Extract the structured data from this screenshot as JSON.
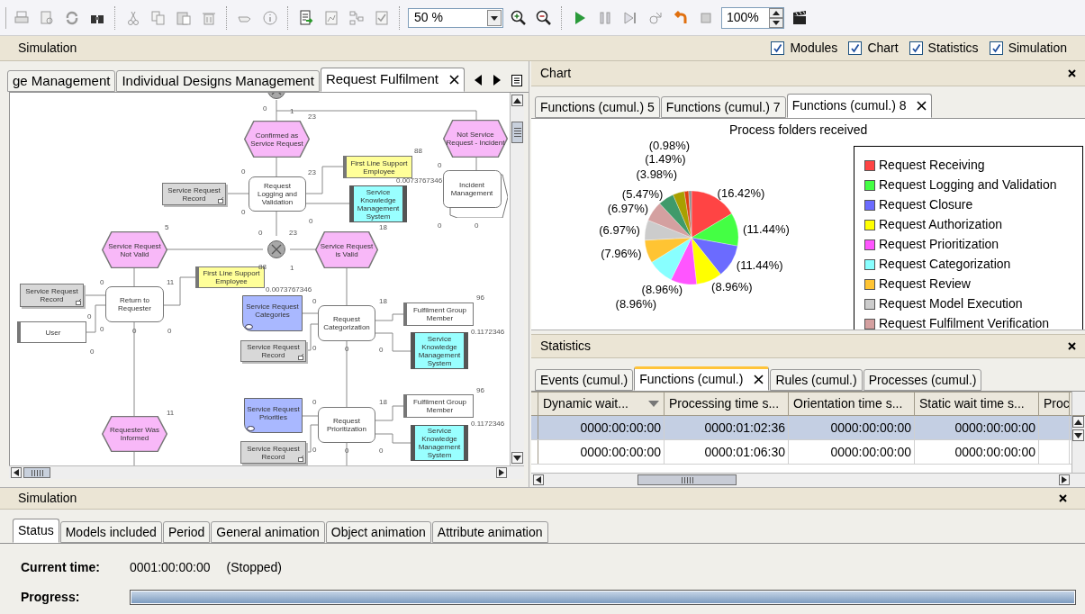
{
  "toolbar": {
    "zoom": "50 %",
    "speed": "100%"
  },
  "simulation_bar": {
    "title": "Simulation",
    "panels": [
      {
        "label": "Modules",
        "checked": true
      },
      {
        "label": "Chart",
        "checked": true
      },
      {
        "label": "Statistics",
        "checked": true
      },
      {
        "label": "Simulation",
        "checked": true
      }
    ]
  },
  "model_tabs": [
    {
      "label": "ge Management",
      "selected": false
    },
    {
      "label": "Individual Designs Management",
      "selected": false
    },
    {
      "label": "Request Fulfilment",
      "selected": true
    }
  ],
  "diagram": {
    "nodes": [
      {
        "kind": "event",
        "label": "Confirmed as Service Request"
      },
      {
        "kind": "event",
        "label": "Not Service Request - Incident"
      },
      {
        "kind": "xor"
      },
      {
        "kind": "function",
        "label": "Request Logging and Validation"
      },
      {
        "kind": "organisation",
        "label": "First Line Support Employee"
      },
      {
        "kind": "information",
        "label": "Service Request Record"
      },
      {
        "kind": "application",
        "label": "Service Knowledge Management System"
      },
      {
        "kind": "process_interface",
        "label": "Incident Management"
      },
      {
        "kind": "xor"
      },
      {
        "kind": "event",
        "label": "Service Request Not Valid"
      },
      {
        "kind": "event",
        "label": "Service Request is Valid"
      },
      {
        "kind": "organisation",
        "label": "First Line Support Employee"
      },
      {
        "kind": "information",
        "label": "Service Request Record"
      },
      {
        "kind": "function",
        "label": "Return to Requester"
      },
      {
        "kind": "position",
        "label": "User"
      },
      {
        "kind": "document",
        "label": "Service Request Categories"
      },
      {
        "kind": "function",
        "label": "Request Categorization"
      },
      {
        "kind": "position",
        "label": "Fulfilment Group Member"
      },
      {
        "kind": "information",
        "label": "Service Request Record"
      },
      {
        "kind": "application",
        "label": "Service Knowledge Management System"
      },
      {
        "kind": "event",
        "label": "Requester Was Informed"
      },
      {
        "kind": "document",
        "label": "Service Request Priorities"
      },
      {
        "kind": "function",
        "label": "Request Prioritization"
      },
      {
        "kind": "position",
        "label": "Fulfilment Group Member"
      },
      {
        "kind": "information",
        "label": "Service Request Record"
      },
      {
        "kind": "application",
        "label": "Service Knowledge Management System"
      }
    ],
    "labels": [
      "0",
      "1",
      "23",
      "88",
      "0",
      "23",
      "0",
      "0.0073767346",
      "0",
      "0",
      "18",
      "0",
      "0",
      "5",
      "0",
      "23",
      "88",
      "1",
      "0",
      "11",
      "0",
      "0",
      "0",
      "0",
      "0",
      "0.0073767346",
      "0",
      "18",
      "96",
      "0.1172346",
      "0",
      "0",
      "0",
      "11",
      "0",
      "18",
      "96",
      "0.1172346",
      "0",
      "0",
      "0"
    ]
  },
  "chart": {
    "title": "Chart",
    "tabs": [
      {
        "label": "Functions (cumul.) 5",
        "selected": false
      },
      {
        "label": "Functions (cumul.) 7",
        "selected": false
      },
      {
        "label": "Functions (cumul.) 8",
        "selected": true
      }
    ],
    "chart_data": {
      "type": "pie",
      "title": "Process folders received",
      "values": [
        16.42,
        11.44,
        11.44,
        8.96,
        8.96,
        8.96,
        7.96,
        6.97,
        6.97,
        5.47,
        3.98,
        1.49,
        0.98
      ],
      "value_labels": [
        "(16.42%)",
        "(11.44%)",
        "(11.44%)",
        "(8.96%)",
        "(8.96%)",
        "(8.96%)",
        "(7.96%)",
        "(6.97%)",
        "(6.97%)",
        "(5.47%)",
        "(3.98%)",
        "(1.49%)",
        "(0.98%)"
      ]
    },
    "legend": [
      {
        "label": "Request Receiving",
        "color": "#ff4444"
      },
      {
        "label": "Request Logging and Validation",
        "color": "#44ff44"
      },
      {
        "label": "Request Closure",
        "color": "#6b6bff"
      },
      {
        "label": "Request Authorization",
        "color": "#ffff00"
      },
      {
        "label": "Request Prioritization",
        "color": "#ff55ff"
      },
      {
        "label": "Request Categorization",
        "color": "#88ffff"
      },
      {
        "label": "Request Review",
        "color": "#ffc433"
      },
      {
        "label": "Request Model Execution",
        "color": "#cccccc"
      },
      {
        "label": "Request Fulfilment Verification",
        "color": "#d4a0a0"
      }
    ]
  },
  "statistics": {
    "title": "Statistics",
    "tabs": [
      {
        "label": "Events (cumul.)",
        "selected": false
      },
      {
        "label": "Functions (cumul.)",
        "selected": true
      },
      {
        "label": "Rules (cumul.)",
        "selected": false
      },
      {
        "label": "Processes (cumul.)",
        "selected": false
      }
    ],
    "columns": [
      {
        "label": "Dynamic wait...",
        "sorted": true
      },
      {
        "label": "Processing time s...",
        "sorted": false
      },
      {
        "label": "Orientation time s...",
        "sorted": false
      },
      {
        "label": "Static wait time s...",
        "sorted": false
      },
      {
        "label": "Proc"
      }
    ],
    "rows": [
      {
        "selected": true,
        "cells": [
          "0000:00:00:00",
          "0000:01:02:36",
          "0000:00:00:00",
          "0000:00:00:00"
        ]
      },
      {
        "selected": false,
        "cells": [
          "0000:00:00:00",
          "0000:01:06:30",
          "0000:00:00:00",
          "0000:00:00:00"
        ]
      }
    ]
  },
  "simulation": {
    "title": "Simulation",
    "tabs": [
      {
        "label": "Status",
        "selected": true
      },
      {
        "label": "Models included",
        "selected": false
      },
      {
        "label": "Period",
        "selected": false
      },
      {
        "label": "General animation",
        "selected": false
      },
      {
        "label": "Object animation",
        "selected": false
      },
      {
        "label": "Attribute animation",
        "selected": false
      }
    ],
    "current_time_label": "Current time:",
    "current_time": "0001:00:00:00",
    "state": "(Stopped)",
    "progress_label": "Progress:",
    "progress": {
      "level": 1
    }
  }
}
